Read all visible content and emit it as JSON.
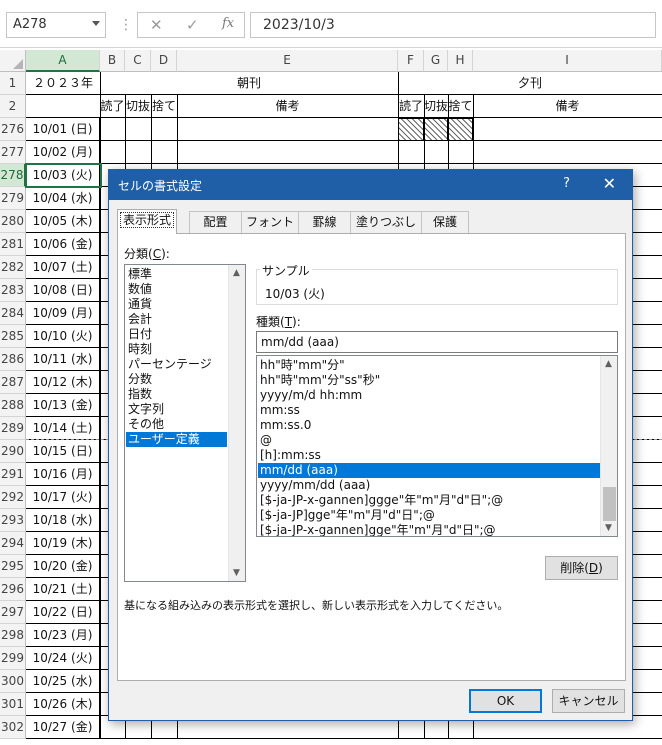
{
  "formula_bar": {
    "name_box": "A278",
    "cancel_glyph": "✕",
    "enter_glyph": "✓",
    "fx_label": "fx",
    "formula": "2023/10/3"
  },
  "sheet": {
    "columns": [
      "A",
      "B",
      "C",
      "D",
      "E",
      "F",
      "G",
      "H",
      "I"
    ],
    "selected_column": "A",
    "header_row1": {
      "year": "２０２３年",
      "morning": "朝刊",
      "evening": "夕刊"
    },
    "header_row2": {
      "b": "読了",
      "c": "切抜",
      "d": "捨て",
      "e": "備考",
      "f": "読了",
      "g": "切抜",
      "h": "捨て",
      "i": "備考"
    },
    "row_numbers": [
      "1",
      "2",
      "276",
      "277",
      "278",
      "279",
      "280",
      "281",
      "282",
      "283",
      "284",
      "285",
      "286",
      "287",
      "288",
      "289",
      "290",
      "291",
      "292",
      "293",
      "294",
      "295",
      "296",
      "297",
      "298",
      "299",
      "300",
      "301",
      "302"
    ],
    "selected_row": "278",
    "dates": [
      "10/01 (日)",
      "10/02 (月)",
      "10/03 (火)",
      "10/04 (水)",
      "10/05 (木)",
      "10/06 (金)",
      "10/07 (土)",
      "10/08 (日)",
      "10/09 (月)",
      "10/10 (火)",
      "10/11 (水)",
      "10/12 (木)",
      "10/13 (金)",
      "10/14 (土)",
      "10/15 (日)",
      "10/16 (月)",
      "10/17 (火)",
      "10/18 (水)",
      "10/19 (木)",
      "10/20 (金)",
      "10/21 (土)",
      "10/22 (日)",
      "10/23 (月)",
      "10/24 (火)",
      "10/25 (水)",
      "10/26 (木)",
      "10/27 (金)"
    ]
  },
  "dialog": {
    "title": "セルの書式設定",
    "help": "?",
    "close": "✕",
    "tabs": [
      "表示形式",
      "配置",
      "フォント",
      "罫線",
      "塗りつぶし",
      "保護"
    ],
    "active_tab": "表示形式",
    "category_label": "分類(",
    "category_key": "C",
    "category_label_end": "):",
    "categories": [
      "標準",
      "数値",
      "通貨",
      "会計",
      "日付",
      "時刻",
      "パーセンテージ",
      "分数",
      "指数",
      "文字列",
      "その他",
      "ユーザー定義"
    ],
    "selected_category": "ユーザー定義",
    "sample_label": "サンプル",
    "sample_value": "10/03 (火)",
    "type_label": "種類(",
    "type_key": "T",
    "type_label_end": "):",
    "type_value": "mm/dd (aaa)",
    "types": [
      "hh\"時\"mm\"分\"",
      "hh\"時\"mm\"分\"ss\"秒\"",
      "yyyy/m/d hh:mm",
      "mm:ss",
      "mm:ss.0",
      "@",
      "[h]:mm:ss",
      "mm/dd (aaa)",
      "yyyy/mm/dd (aaa)",
      "[$-ja-JP-x-gannen]ggge\"年\"m\"月\"d\"日\";@",
      "[$-ja-JP]gge\"年\"m\"月\"d\"日\";@",
      "[$-ja-JP-x-gannen]gge\"年\"m\"月\"d\"日\";@"
    ],
    "selected_type": "mm/dd (aaa)",
    "delete_button": "削除(",
    "delete_key": "D",
    "delete_end": ")",
    "description": "基になる組み込みの表示形式を選択し、新しい表示形式を入力してください。",
    "ok_button": "OK",
    "cancel_button": "キャンセル",
    "scroll_up": "▲",
    "scroll_down": "▼"
  },
  "colors": {
    "accent": "#217346",
    "dialog_title": "#1f5fa8",
    "selection": "#0078d7"
  }
}
